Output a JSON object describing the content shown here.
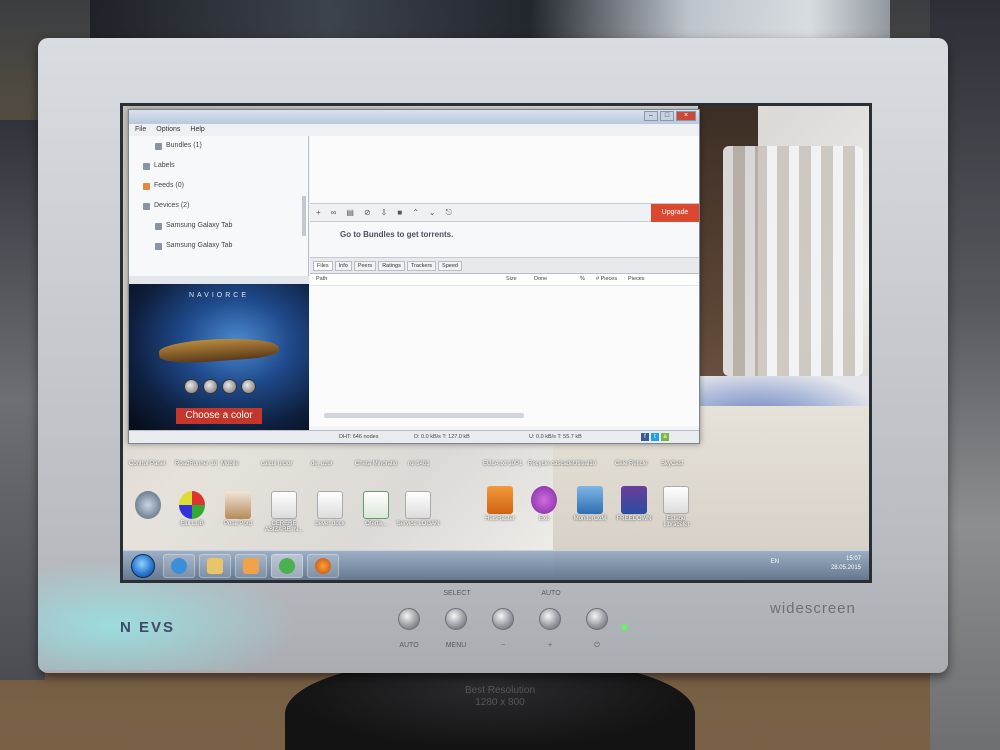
{
  "monitor": {
    "brand": "N  EVS",
    "model_text": "widescreen",
    "buttons_top": [
      "SELECT",
      "AUTO"
    ],
    "buttons_bottom": [
      "AUTO",
      "MENU",
      "−",
      "+",
      "⏻"
    ],
    "stand_label": "Best Resolution 1280 x 800"
  },
  "app": {
    "menu": [
      "File",
      "Options",
      "Help"
    ],
    "sidebar": [
      {
        "label": "Bundles (1)",
        "sub": true
      },
      {
        "label": "Labels",
        "sub": false
      },
      {
        "label": "Feeds (0)",
        "sub": false
      },
      {
        "label": "Devices (2)",
        "sub": false
      },
      {
        "label": "Samsung Galaxy Tab",
        "sub": true
      },
      {
        "label": "Samsung Galaxy Tab",
        "sub": true
      }
    ],
    "ad": {
      "title": "NAVIORCE",
      "cta": "Choose a color"
    },
    "upgrade_label": "Upgrade",
    "bundles_text": "Go to Bundles to get torrents.",
    "tabs": [
      "Files",
      "Info",
      "Peers",
      "Ratings",
      "Trackers",
      "Speed"
    ],
    "file_columns": [
      "Path",
      "Size",
      "Done",
      "%",
      "# Pieces",
      "Pieces"
    ],
    "status": {
      "dht": "DHT: 646 nodes",
      "down": "D: 0.0 kB/s T: 127.0 kB",
      "up": "U: 0.0 kB/s T: 55.7 kB"
    }
  },
  "desktop": {
    "top_row": [
      "Control Panel",
      "RoadRunner 10",
      "Mobile",
      "calcul ulcior",
      "de_uzur",
      "Cheta Minoratio",
      "roi 14b1",
      "EULA.txt 10P1",
      "Recycle cascade",
      "Utilsal10",
      "Cale Reticle",
      "SkyCast"
    ],
    "icons": [
      {
        "label": "",
        "kind": "cam"
      },
      {
        "label": "Elul LUB",
        "kind": "chart"
      },
      {
        "label": "Pose Pord",
        "kind": "pdf"
      },
      {
        "label": "CERERE ASIZARE IN...",
        "kind": "doc"
      },
      {
        "label": "dever docx",
        "kind": "doc"
      },
      {
        "label": "Oferta...",
        "kind": "excel"
      },
      {
        "label": "Service LOGAN",
        "kind": "doc"
      },
      {
        "label": "HeisRaster",
        "kind": "orange"
      },
      {
        "label": "Exit",
        "kind": "purple"
      },
      {
        "label": "MonitorCoM",
        "kind": "net"
      },
      {
        "label": "FREEDOWN",
        "kind": "rar"
      },
      {
        "label": "Estage 1 bracelet",
        "kind": "doc"
      }
    ]
  },
  "taskbar": {
    "lang": "EN",
    "time": "15:07",
    "date": "28.05.2015"
  }
}
